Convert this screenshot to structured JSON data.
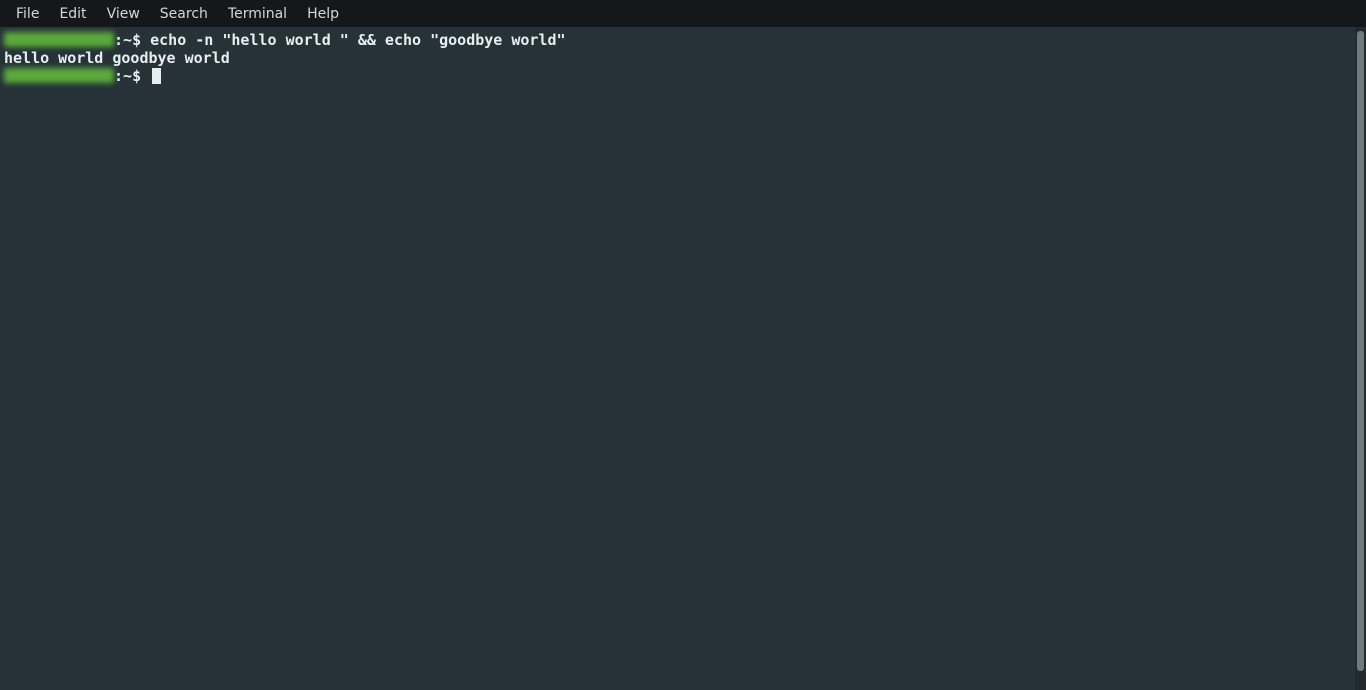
{
  "menu": {
    "items": [
      "File",
      "Edit",
      "View",
      "Search",
      "Terminal",
      "Help"
    ]
  },
  "terminal": {
    "lines": [
      {
        "user_host": "██████████",
        "sep": ":",
        "path": "~",
        "dollar": "$",
        "command": "echo -n \"hello world \" && echo \"goodbye world\""
      },
      {
        "output": "hello world goodbye world"
      },
      {
        "user_host": "██████████",
        "sep": ":",
        "path": "~",
        "dollar": "$",
        "command": ""
      }
    ]
  }
}
